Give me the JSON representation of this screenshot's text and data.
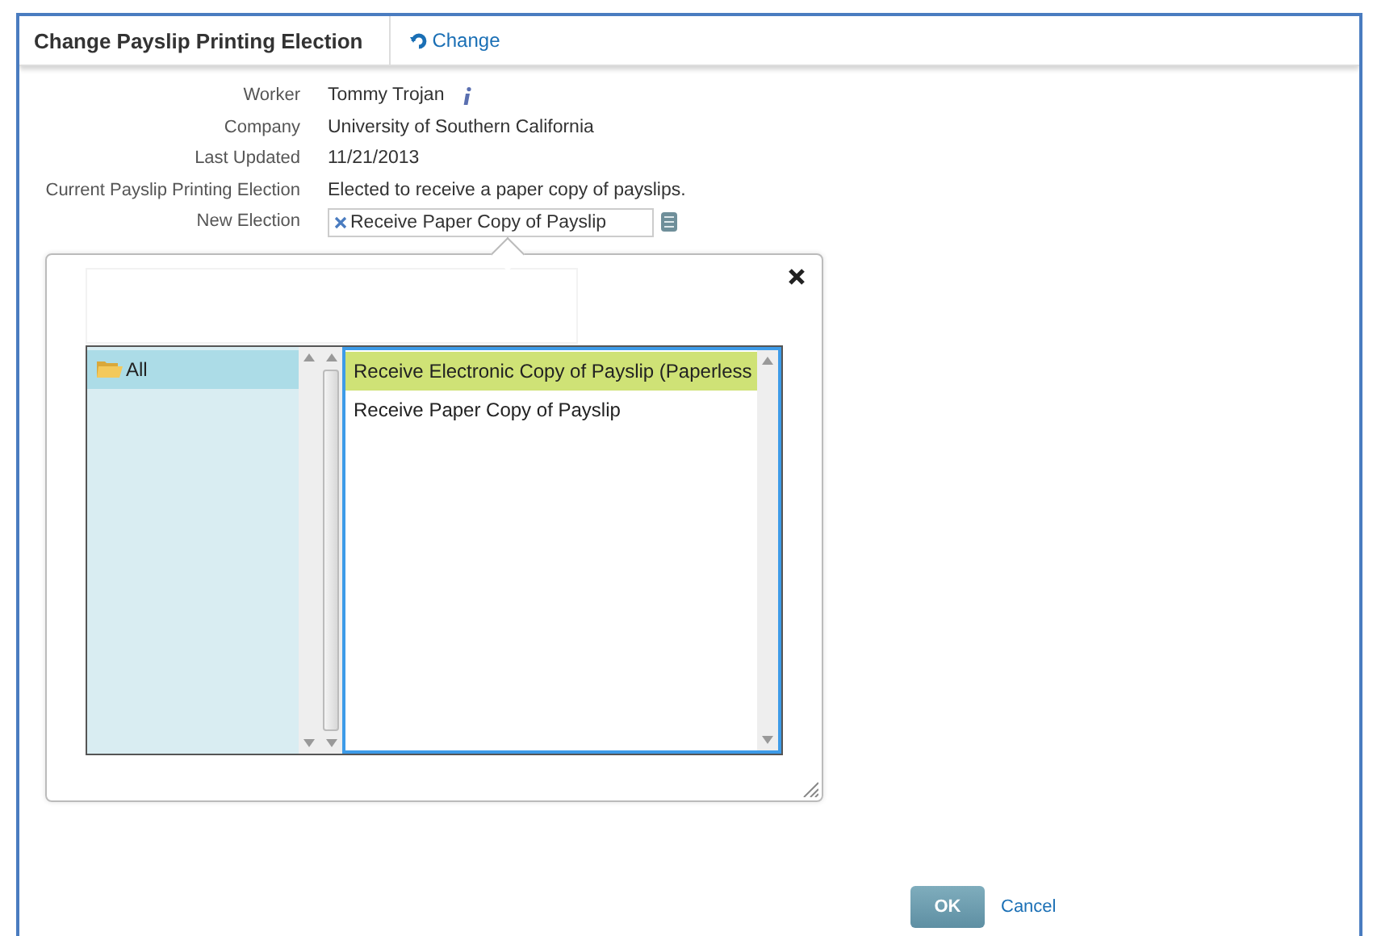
{
  "header": {
    "title": "Change Payslip Printing Election",
    "action": "Change"
  },
  "fields": [
    {
      "label": "Worker",
      "value": "Tommy Trojan",
      "kind": "info"
    },
    {
      "label": "Company",
      "value": "University of Southern California",
      "kind": "text"
    },
    {
      "label": "Last Updated",
      "value": "11/21/2013",
      "kind": "text"
    },
    {
      "label": "Current Payslip Printing Election",
      "value": "Elected to receive a paper copy of payslips.",
      "kind": "text"
    },
    {
      "label": "New Election",
      "value": "Receive Paper Copy of Payslip",
      "kind": "chip"
    }
  ],
  "prompt": {
    "categories": [
      {
        "label": "All",
        "selected": true
      }
    ],
    "options": [
      {
        "label": "Receive Electronic Copy of Payslip (Paperless",
        "selected": true
      },
      {
        "label": "Receive Paper Copy of Payslip",
        "selected": false
      }
    ]
  },
  "buttons": [
    {
      "label": "OK",
      "kind": "primary"
    },
    {
      "label": "Cancel",
      "kind": "link"
    }
  ]
}
